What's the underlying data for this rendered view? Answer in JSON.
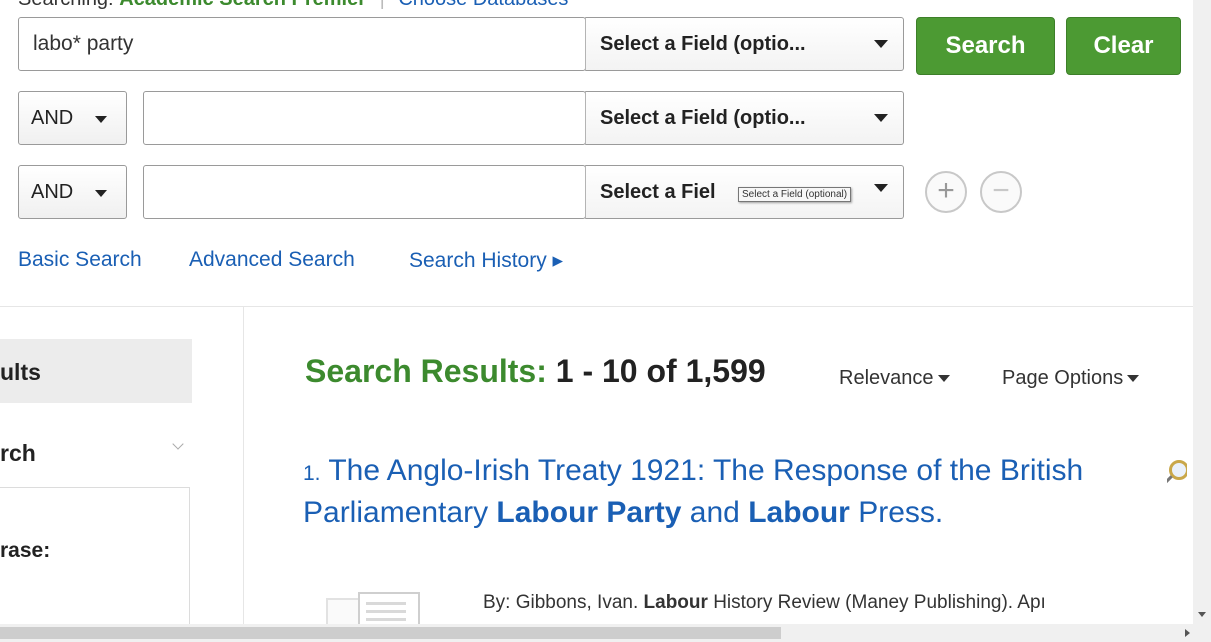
{
  "header": {
    "searching_label": "Searching:",
    "database_name": "Academic Search Premier",
    "choose_databases": "Choose Databases"
  },
  "search_rows": [
    {
      "boolean": "",
      "value": "labo* party",
      "field": "Select a Field (optio..."
    },
    {
      "boolean": "AND",
      "value": "",
      "field": "Select a Field (optio..."
    },
    {
      "boolean": "AND",
      "value": "",
      "field": "Select a Fiel"
    }
  ],
  "buttons": {
    "search": "Search",
    "clear": "Clear",
    "add_row": "+",
    "remove_row": "−"
  },
  "tooltip": "Select a Field (optional)",
  "links": {
    "basic_search": "Basic Search",
    "advanced_search": "Advanced Search",
    "search_history": "Search History ▸"
  },
  "sidebar": {
    "header": "ults",
    "section": "rch",
    "phrase": "rase:"
  },
  "results": {
    "label": "Search Results:",
    "count": "1 - 10 of 1,599",
    "sort": "Relevance",
    "page_options": "Page Options",
    "items": [
      {
        "number": "1.",
        "title_part1": "The Anglo-Irish Treaty 1921: The Response of the British Parliamentary ",
        "title_bold1": "Labour Party",
        "title_part2": " and ",
        "title_bold2": "Labour",
        "title_part3": " Press.",
        "by_prefix": "By: Gibbons, Ivan. ",
        "by_bold": "Labour",
        "by_suffix": " History Review (Maney Publishing). Apı"
      }
    ]
  },
  "colors": {
    "accent_green": "#4c9a33",
    "link_blue": "#1a5fb4"
  }
}
